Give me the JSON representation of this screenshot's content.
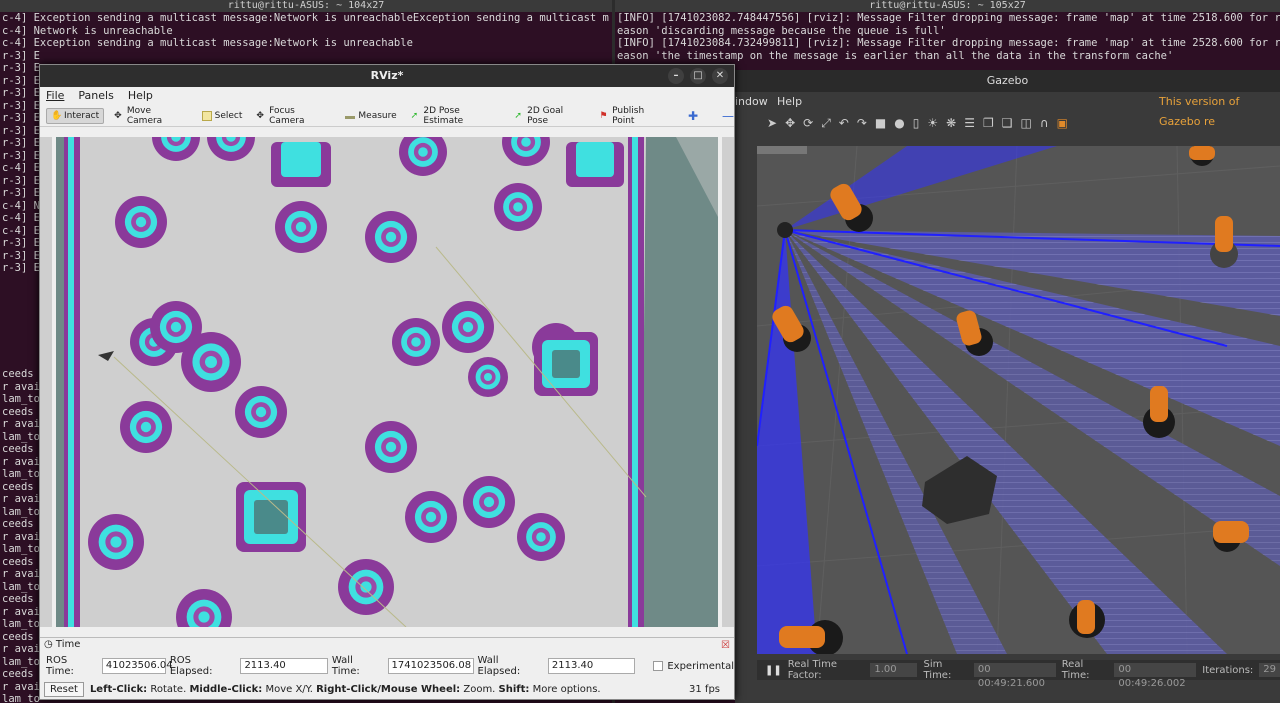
{
  "terminal_left": {
    "title": "rittu@rittu-ASUS: ~ 104x27",
    "lines": [
      "c-4] Exception sending a multicast message:Network is unreachableException sending a multicast m",
      "",
      "c-4] Network is unreachable",
      "c-4] Exception sending a multicast message:Network is unreachable",
      "r-3] E",
      "r-3] E",
      "r-3] E",
      "r-3] E",
      "r-3] E",
      "r-3] E",
      "r-3] E",
      "r-3] E",
      "r-3] E",
      "c-4] E",
      "r-3] E",
      "r-3] E",
      "",
      "c-4] N",
      "c-4] E",
      "c-4] E",
      "r-3] E",
      "r-3] E",
      "r-3] E"
    ],
    "lower_lines": [
      "ceeds",
      "r avai",
      "lam_to",
      "ceeds",
      "r avai",
      "lam_to",
      "ceeds",
      "r avai",
      "lam_to",
      "ceeds",
      "r avai",
      "lam_to",
      "ceeds",
      "r avai",
      "lam_to",
      "ceeds",
      "r avai",
      "lam_to",
      "ceeds",
      "r avai",
      "lam_to",
      "ceeds",
      "r avai",
      "lam_to",
      "ceeds",
      "r avai",
      "lam_to"
    ]
  },
  "terminal_right": {
    "title": "rittu@rittu-ASUS: ~ 105x27",
    "lines": [
      "[INFO] [1741023082.748447556] [rviz]: Message Filter dropping message: frame 'map' at time 2518.600 for r",
      "eason 'discarding message because the queue is full'",
      "[INFO] [1741023084.732499811] [rviz]: Message Filter dropping message: frame 'map' at time 2528.600 for r",
      "eason 'the timestamp on the message is earlier than all the data in the transform cache'"
    ]
  },
  "rviz": {
    "title": "RViz*",
    "menu": [
      "File",
      "Panels",
      "Help"
    ],
    "tools": [
      {
        "label": "Interact",
        "icon": "hand-icon",
        "active": true
      },
      {
        "label": "Move Camera",
        "icon": "move-camera-icon"
      },
      {
        "label": "Select",
        "icon": "select-icon"
      },
      {
        "label": "Focus Camera",
        "icon": "focus-camera-icon"
      },
      {
        "label": "Measure",
        "icon": "measure-icon"
      },
      {
        "label": "2D Pose Estimate",
        "icon": "pose-estimate-icon"
      },
      {
        "label": "2D Goal Pose",
        "icon": "goal-pose-icon"
      },
      {
        "label": "Publish Point",
        "icon": "publish-point-icon"
      }
    ],
    "time_panel": {
      "title": "Time",
      "ros_time_label": "ROS Time:",
      "ros_time": "41023506.04",
      "ros_elapsed_label": "ROS Elapsed:",
      "ros_elapsed": "2113.40",
      "wall_time_label": "Wall Time:",
      "wall_time": "1741023506.08",
      "wall_elapsed_label": "Wall Elapsed:",
      "wall_elapsed": "2113.40",
      "experimental_label": "Experimental"
    },
    "status": {
      "reset_label": "Reset",
      "left_click": "Left-Click:",
      "left_click_desc": " Rotate. ",
      "middle_click": "Middle-Click:",
      "middle_click_desc": " Move X/Y. ",
      "right_click": "Right-Click/Mouse Wheel:",
      "right_click_desc": " Zoom. ",
      "shift": "Shift:",
      "shift_desc": " More options.",
      "fps": "31 fps"
    },
    "colors": {
      "cyan": "#3fe0e0",
      "purple": "#8a3a9a",
      "magenta": "#c0389a",
      "map_bg": "#cfcfcf",
      "unknown": "#6f8a87"
    }
  },
  "gazebo": {
    "title": "Gazebo",
    "menu": [
      "indow",
      "Help"
    ],
    "notice": "This version of Gazebo re",
    "bottom": {
      "rtf_label": "Real Time Factor:",
      "rtf": "1.00",
      "sim_label": "Sim Time:",
      "sim": "00 00:49:21.600",
      "real_label": "Real Time:",
      "real": "00 00:49:26.002",
      "iter_label": "Iterations:",
      "iter": "29"
    }
  }
}
